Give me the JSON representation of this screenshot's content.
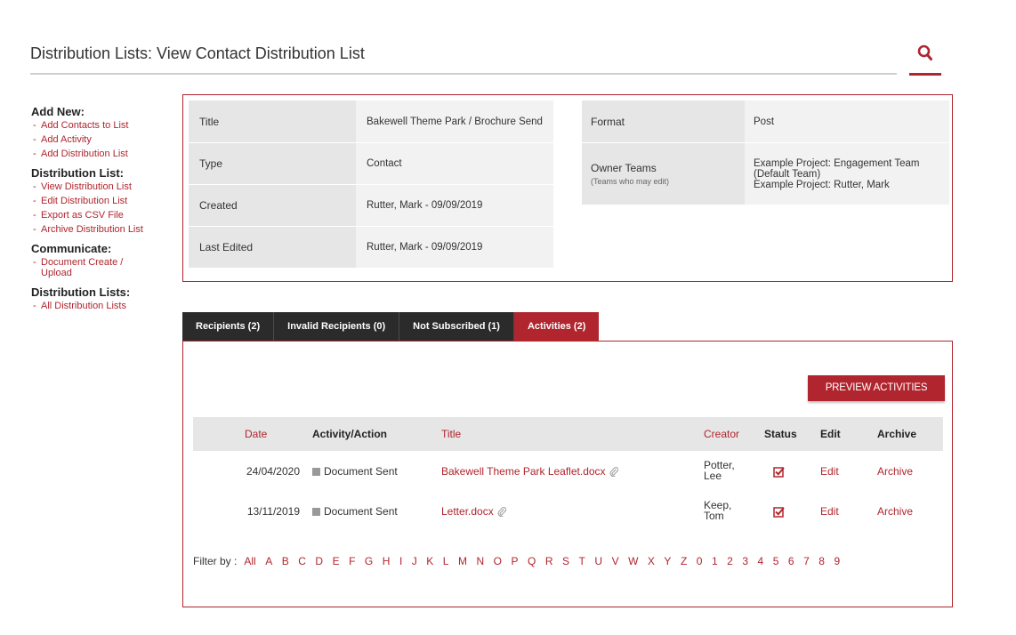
{
  "page": {
    "title": "Distribution Lists: View Contact Distribution List"
  },
  "colors": {
    "accent": "#b0252e",
    "tab_dark": "#2b2b2b",
    "label_bg": "#e6e6e6",
    "value_bg": "#f2f2f2"
  },
  "icons": {
    "search": "search-icon",
    "attachment": "paperclip-icon",
    "status": "checkbox-checked-icon",
    "action_type": "square-icon"
  },
  "sidebar": {
    "sections": [
      {
        "heading": "Add New:",
        "items": [
          "Add Contacts to List",
          "Add Activity",
          "Add Distribution List"
        ]
      },
      {
        "heading": "Distribution List:",
        "items": [
          "View Distribution List",
          "Edit Distribution List",
          "Export as CSV File",
          "Archive Distribution List"
        ]
      },
      {
        "heading": "Communicate:",
        "items": [
          "Document Create / Upload"
        ]
      },
      {
        "heading": "Distribution Lists:",
        "items": [
          "All Distribution Lists"
        ]
      }
    ]
  },
  "details": {
    "title_label": "Title",
    "title_value": "Bakewell Theme Park / Brochure Send",
    "type_label": "Type",
    "type_value": "Contact",
    "created_label": "Created",
    "created_value": "Rutter, Mark - 09/09/2019",
    "edited_label": "Last Edited",
    "edited_value": "Rutter, Mark - 09/09/2019",
    "format_label": "Format",
    "format_value": "Post",
    "owner_label": "Owner Teams",
    "owner_note": "(Teams who may edit)",
    "owner_value_1": "Example Project: Engagement Team (Default Team)",
    "owner_value_2": "Example Project: Rutter, Mark"
  },
  "tabs": [
    {
      "label": "Recipients (2)",
      "active": false
    },
    {
      "label": "Invalid Recipients (0)",
      "active": false
    },
    {
      "label": "Not Subscribed (1)",
      "active": false
    },
    {
      "label": "Activities (2)",
      "active": true
    }
  ],
  "activities": {
    "preview_button": "PREVIEW ACTIVITIES",
    "columns": {
      "date": "Date",
      "action": "Activity/Action",
      "title": "Title",
      "creator": "Creator",
      "status": "Status",
      "edit": "Edit",
      "archive": "Archive"
    },
    "rows": [
      {
        "date": "24/04/2020",
        "action": "Document Sent",
        "title": "Bakewell Theme Park Leaflet.docx",
        "creator_1": "Potter,",
        "creator_2": "Lee",
        "edit": "Edit",
        "archive": "Archive"
      },
      {
        "date": "13/11/2019",
        "action": "Document Sent",
        "title": "Letter.docx",
        "creator_1": "Keep,",
        "creator_2": "Tom",
        "edit": "Edit",
        "archive": "Archive"
      }
    ]
  },
  "filter": {
    "label": "Filter by :",
    "letters": [
      "All",
      "A",
      "B",
      "C",
      "D",
      "E",
      "F",
      "G",
      "H",
      "I",
      "J",
      "K",
      "L",
      "M",
      "N",
      "O",
      "P",
      "Q",
      "R",
      "S",
      "T",
      "U",
      "V",
      "W",
      "X",
      "Y",
      "Z",
      "0",
      "1",
      "2",
      "3",
      "4",
      "5",
      "6",
      "7",
      "8",
      "9"
    ]
  }
}
